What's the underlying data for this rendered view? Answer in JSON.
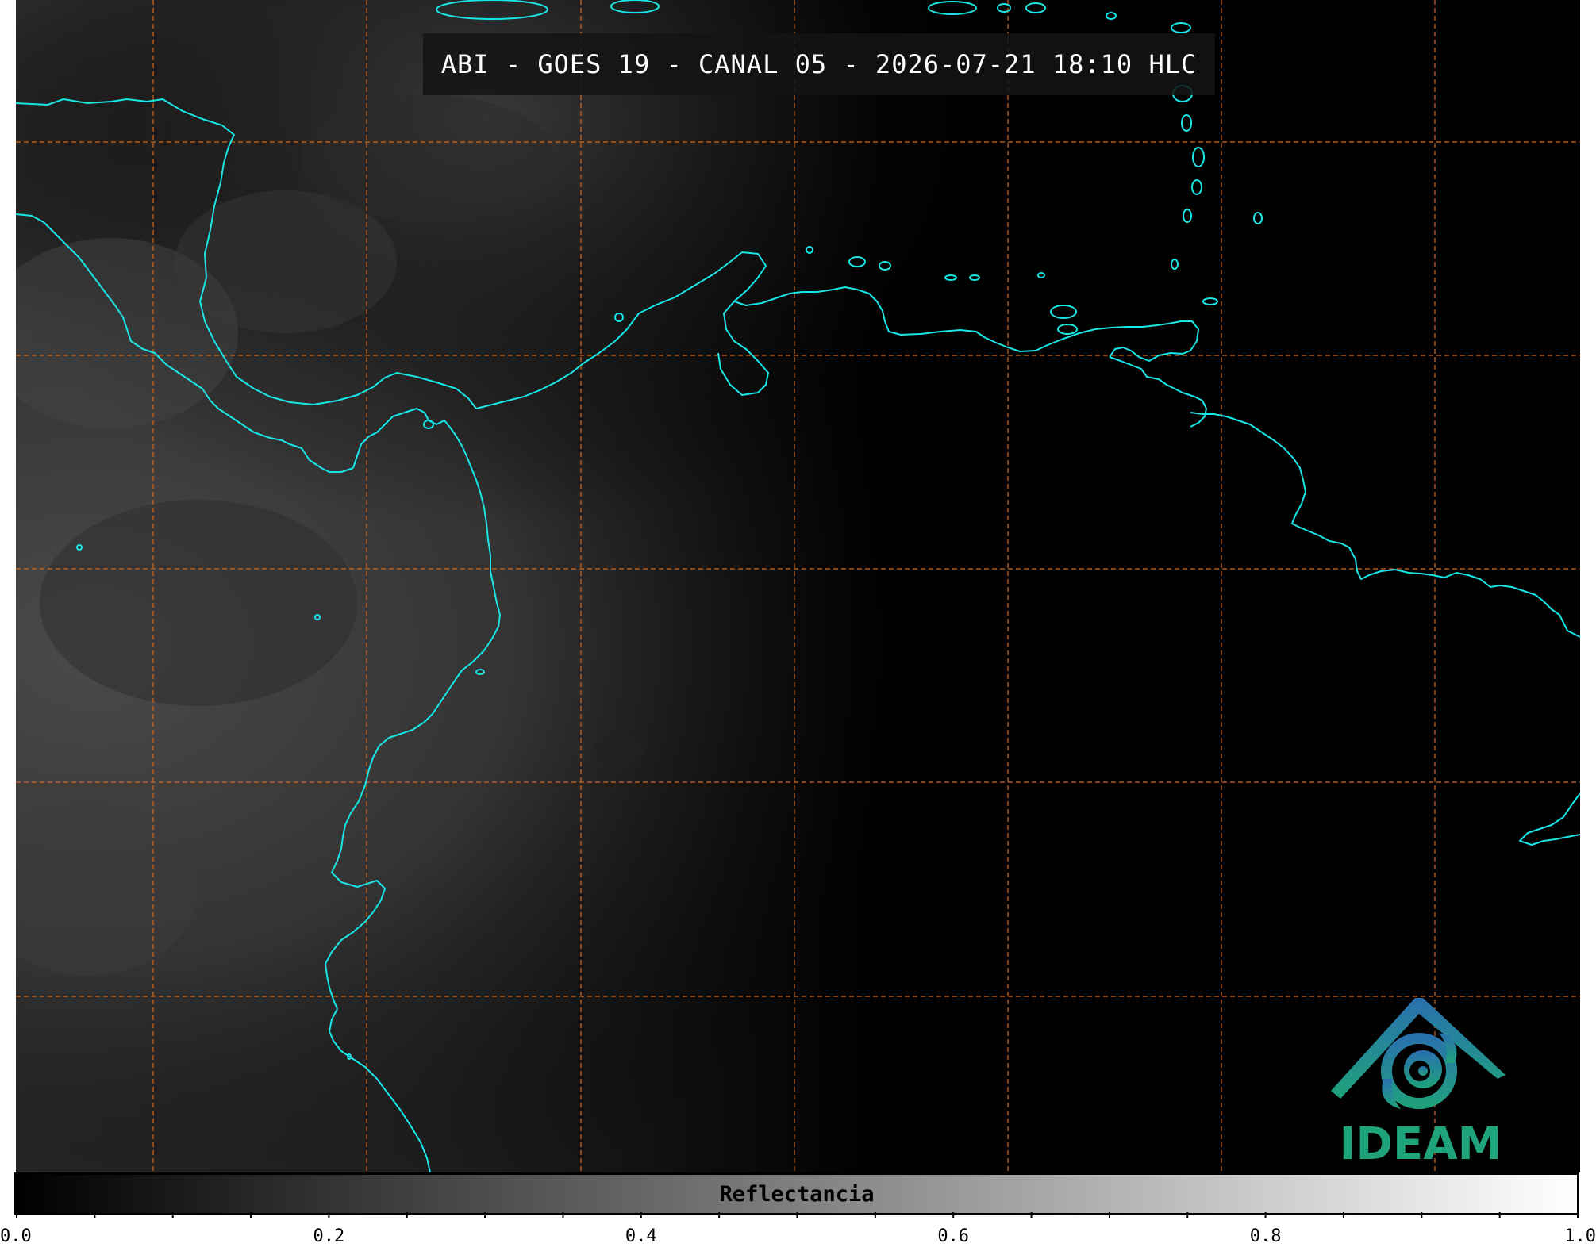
{
  "title": "ABI - GOES 19 - CANAL 05 - 2026-07-21 18:10 HLC",
  "colorbar": {
    "label": "Reflectancia",
    "range": [
      0.0,
      1.0
    ],
    "colormap": "grayscale (black to white)",
    "major_ticks": [
      {
        "value": 0.0,
        "label": "0.0"
      },
      {
        "value": 0.2,
        "label": "0.2"
      },
      {
        "value": 0.4,
        "label": "0.4"
      },
      {
        "value": 0.6,
        "label": "0.6"
      },
      {
        "value": 0.8,
        "label": "0.8"
      },
      {
        "value": 1.0,
        "label": "1.0"
      }
    ],
    "minor_tick_step": 0.05
  },
  "logo": {
    "text": "IDEAM",
    "icon": "ideam-logo-icon"
  },
  "colors": {
    "coastline": "#19e6e6",
    "gridlines": "#d2691e",
    "background": "#000000",
    "logo_green": "#1fa37a",
    "logo_blue": "#2a6fb0"
  }
}
